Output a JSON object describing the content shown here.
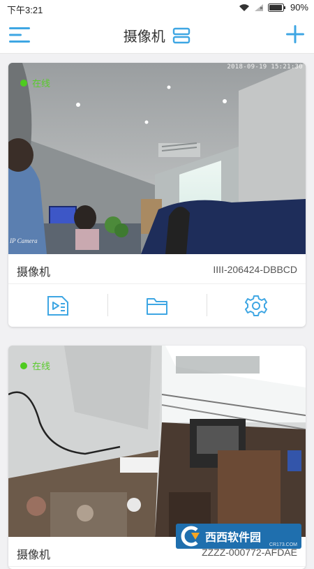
{
  "status_bar": {
    "time": "下午3:21",
    "battery": "90%"
  },
  "header": {
    "title": "摄像机"
  },
  "cameras": [
    {
      "status": "在线",
      "timestamp": "2018-09-19 15:21:30",
      "overlay": "IP Camera",
      "name": "摄像机",
      "device_id": "IIII-206424-DBBCD"
    },
    {
      "status": "在线",
      "name": "摄像机",
      "device_id": "ZZZZ-000772-AFDAE"
    }
  ],
  "watermark": {
    "text": "西西软件园",
    "sub": "CR173.COM"
  },
  "colors": {
    "accent": "#3ea6e3",
    "online": "#4ecb1f",
    "background": "#f1f1f3"
  }
}
